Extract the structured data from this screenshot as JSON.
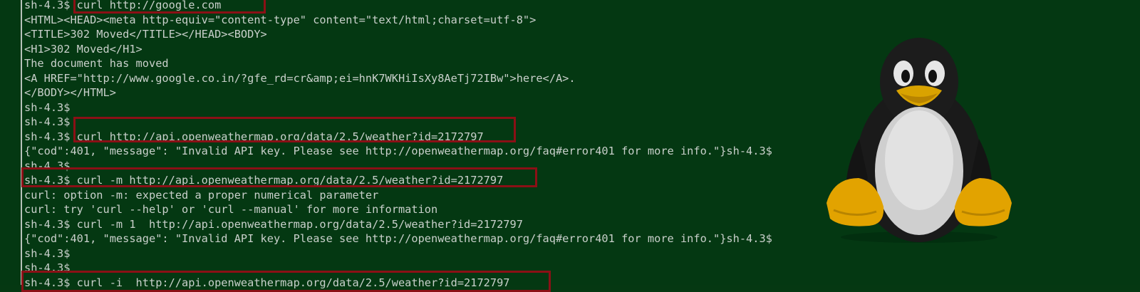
{
  "terminal": {
    "lines": [
      "sh-4.3$ curl http://google.com",
      "<HTML><HEAD><meta http-equiv=\"content-type\" content=\"text/html;charset=utf-8\">",
      "<TITLE>302 Moved</TITLE></HEAD><BODY>",
      "<H1>302 Moved</H1>",
      "The document has moved",
      "<A HREF=\"http://www.google.co.in/?gfe_rd=cr&amp;ei=hnK7WKHiIsXy8AeTj72IBw\">here</A>.",
      "</BODY></HTML>",
      "sh-4.3$",
      "sh-4.3$",
      "sh-4.3$ curl http://api.openweathermap.org/data/2.5/weather?id=2172797",
      "{\"cod\":401, \"message\": \"Invalid API key. Please see http://openweathermap.org/faq#error401 for more info.\"}sh-4.3$",
      "sh-4.3$",
      "sh-4.3$ curl -m http://api.openweathermap.org/data/2.5/weather?id=2172797",
      "curl: option -m: expected a proper numerical parameter",
      "curl: try 'curl --help' or 'curl --manual' for more information",
      "sh-4.3$ curl -m 1  http://api.openweathermap.org/data/2.5/weather?id=2172797",
      "{\"cod\":401, \"message\": \"Invalid API key. Please see http://openweathermap.org/faq#error401 for more info.\"}sh-4.3$",
      "sh-4.3$",
      "sh-4.3$",
      "sh-4.3$ curl -i  http://api.openweathermap.org/data/2.5/weather?id=2172797"
    ]
  },
  "colors": {
    "background": "#043812",
    "text": "#c9d0cb",
    "highlight_box": "#8b1016"
  },
  "mascot": {
    "icon": "tux-penguin-icon"
  }
}
